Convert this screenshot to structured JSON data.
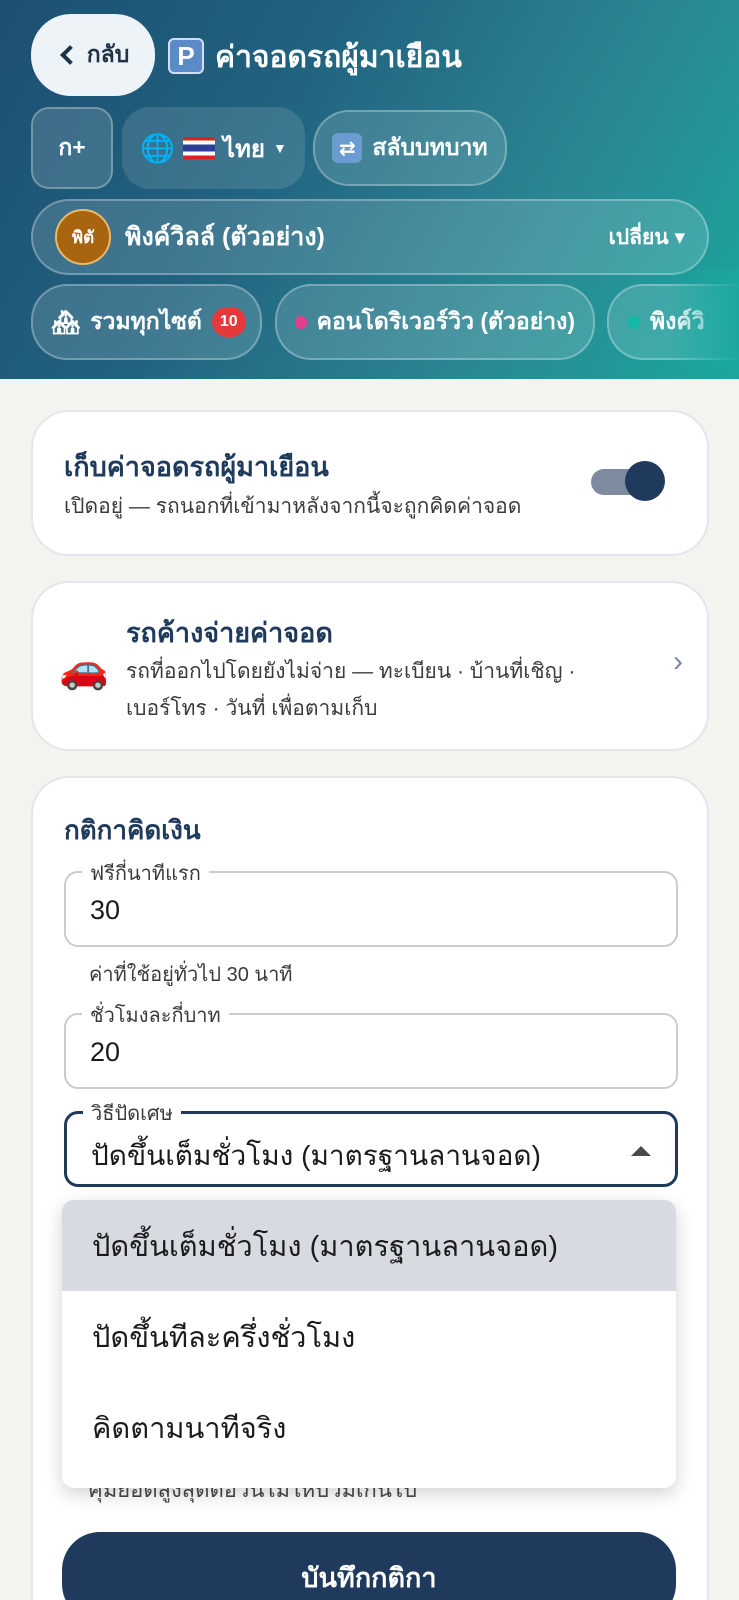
{
  "header": {
    "back_label": "กลับ",
    "title_icon": "P",
    "title": "ค่าจอดรถผู้มาเยือน",
    "kplus_label": "ก+",
    "lang_label": "ไทย",
    "switch_role_label": "สลับบทบาท",
    "site": {
      "avatar_text": "พิตั",
      "name": "พิงค์วิลล์ (ตัวอย่าง)",
      "change_label": "เปลี่ยน ▾"
    },
    "chips": [
      {
        "label": "รวมทุกไซต์",
        "badge": "10"
      },
      {
        "label": "คอนโดริเวอร์วิว (ตัวอย่าง)",
        "dot_color": "#e53e8b"
      },
      {
        "label": "พิงค์วิ",
        "dot_color": "#14b8a6"
      }
    ]
  },
  "toggle_card": {
    "title": "เก็บค่าจอดรถผู้มาเยือน",
    "subtitle": "เปิดอยู่ — รถนอกที่เข้ามาหลังจากนี้จะถูกคิดค่าจอด",
    "enabled": true
  },
  "unpaid_card": {
    "title": "รถค้างจ่ายค่าจอด",
    "subtitle": "รถที่ออกไปโดยยังไม่จ่าย — ทะเบียน · บ้านที่เชิญ · เบอร์โทร · วันที่ เพื่อตามเก็บ"
  },
  "rules": {
    "title": "กติกาคิดเงิน",
    "free_minutes": {
      "label": "ฟรีกี่นาทีแรก",
      "value": "30",
      "helper": "ค่าที่ใช้อยู่ทั่วไป 30 นาที"
    },
    "rate": {
      "label": "ชั่วโมงละกี่บาท",
      "value": "20"
    },
    "rounding": {
      "label": "วิธีปัดเศษ",
      "value": "ปัดขึ้นเต็มชั่วโมง (มาตรฐานลานจอด)",
      "options": [
        "ปัดขึ้นเต็มชั่วโมง (มาตรฐานลานจอด)",
        "ปัดขึ้นทีละครึ่งชั่วโมง",
        "คิดตามนาทีจริง"
      ]
    },
    "partial_hidden_text": "คุมยอดสูงสุดต่อวันไม่ให้บวมเกินไป",
    "save_label": "บันทึกกติกา"
  },
  "colors": {
    "primary": "#1f3a5c",
    "badge": "#e5393b"
  }
}
